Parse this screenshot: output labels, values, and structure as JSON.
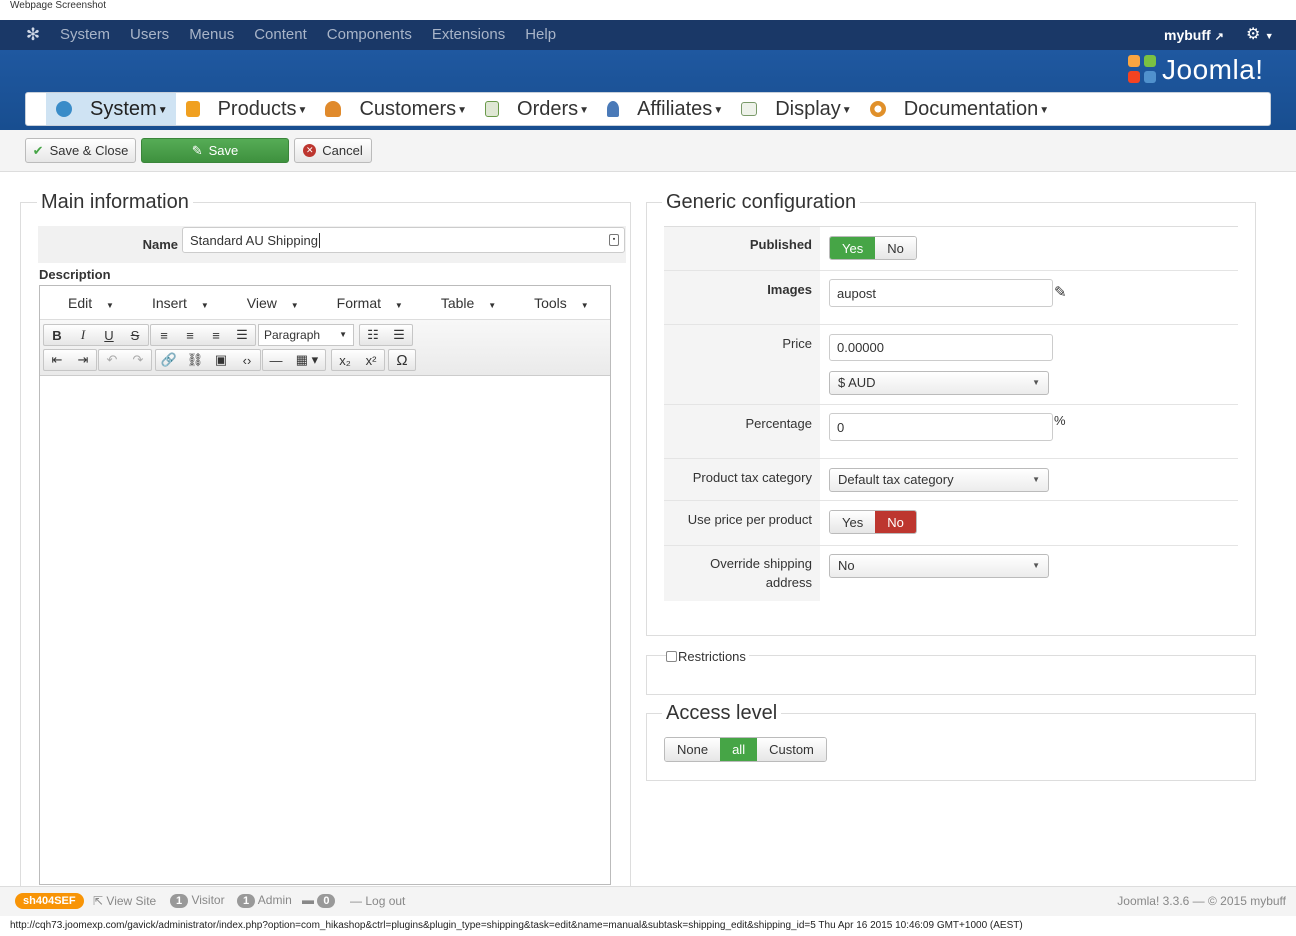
{
  "caption": "Webpage Screenshot",
  "topbar": {
    "menu": [
      "System",
      "Users",
      "Menus",
      "Content",
      "Components",
      "Extensions",
      "Help"
    ],
    "user": "mybuff"
  },
  "brand": {
    "name": "Joomla!"
  },
  "hikanav": [
    {
      "label": "System",
      "icon": "tools-icon",
      "color": "#3a8cc8"
    },
    {
      "label": "Products",
      "icon": "box-icon",
      "color": "#f0a020"
    },
    {
      "label": "Customers",
      "icon": "users-icon",
      "color": "#e08a2c"
    },
    {
      "label": "Orders",
      "icon": "document-icon",
      "color": "#6a9a4a"
    },
    {
      "label": "Affiliates",
      "icon": "affiliate-icon",
      "color": "#4a7ab8"
    },
    {
      "label": "Display",
      "icon": "display-icon",
      "color": "#7a9a6a"
    },
    {
      "label": "Documentation",
      "icon": "lifebuoy-icon",
      "color": "#e0902a"
    }
  ],
  "toolbar": {
    "save_close": "Save & Close",
    "save": "Save",
    "cancel": "Cancel"
  },
  "main": {
    "legend": "Main information",
    "name_label": "Name",
    "name_value": "Standard AU Shipping",
    "description_label": "Description",
    "editor_menu": [
      "Edit",
      "Insert",
      "View",
      "Format",
      "Table",
      "Tools"
    ],
    "paragraph": "Paragraph"
  },
  "config": {
    "legend": "Generic configuration",
    "published_label": "Published",
    "published_yes": "Yes",
    "published_no": "No",
    "images_label": "Images",
    "images_value": "aupost",
    "price_label": "Price",
    "price_value": "0.00000",
    "currency": "$ AUD",
    "percentage_label": "Percentage",
    "percentage_value": "0",
    "percent_sign": "%",
    "tax_label": "Product tax category",
    "tax_value": "Default tax category",
    "perproduct_label": "Use price per product",
    "perproduct_yes": "Yes",
    "perproduct_no": "No",
    "override_label": "Override shipping address",
    "override_value": "No"
  },
  "restrictions": {
    "label": "Restrictions"
  },
  "access": {
    "legend": "Access level",
    "none": "None",
    "all": "all",
    "custom": "Custom"
  },
  "footer": {
    "sef": "sh404SEF",
    "view_site": "View Site",
    "visitors_count": "1",
    "visitors": "Visitor",
    "admins_count": "1",
    "admins": "Admin",
    "messages_count": "0",
    "logout": "Log out",
    "version": "Joomla! 3.3.6  —  © 2015 mybuff"
  },
  "status_url": "http://cqh73.joomexp.com/gavick/administrator/index.php?option=com_hikashop&ctrl=plugins&plugin_type=shipping&task=edit&name=manual&subtask=shipping_edit&shipping_id=5 Thu Apr 16 2015 10:46:09 GMT+1000 (AEST)"
}
